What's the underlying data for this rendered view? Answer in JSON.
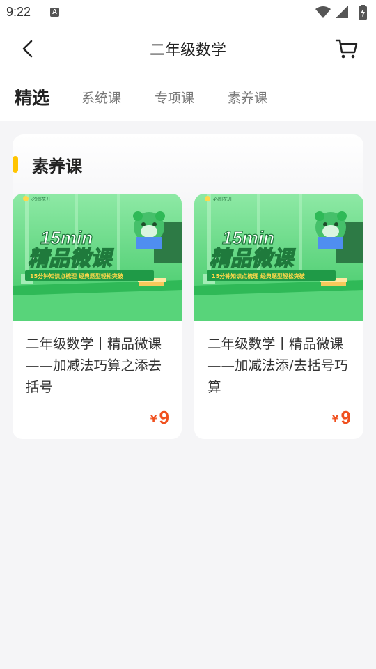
{
  "status_bar": {
    "time": "9:22",
    "notification_icon": "a-icon",
    "icons": [
      "wifi-icon",
      "signal-icon",
      "battery-icon"
    ]
  },
  "header": {
    "title": "二年级数学",
    "back_icon": "back-arrow-icon",
    "cart_icon": "cart-icon"
  },
  "tabs": [
    {
      "label": "精选",
      "active": true
    },
    {
      "label": "系统课",
      "active": false
    },
    {
      "label": "专项课",
      "active": false
    },
    {
      "label": "素养课",
      "active": false
    }
  ],
  "section": {
    "title": "素养课",
    "accent_color": "#ffc400"
  },
  "courses": [
    {
      "title": "二年级数学丨精品微课——加减法巧算之添去括号",
      "currency": "¥",
      "price": "9",
      "thumb": {
        "brand": "必图花开",
        "headline": "15min",
        "subheadline": "精品微课",
        "tagline": "15分钟知识点梳理 经典题型轻松突破"
      }
    },
    {
      "title": "二年级数学丨精品微课——加减法添/去括号巧算",
      "currency": "¥",
      "price": "9",
      "thumb": {
        "brand": "必图花开",
        "headline": "15min",
        "subheadline": "精品微课",
        "tagline": "15分钟知识点梳理 经典题型轻松突破"
      }
    }
  ],
  "colors": {
    "price": "#f0501e",
    "thumb_green": "#3fcf6a",
    "tagline_yellow": "#ffd84a"
  }
}
